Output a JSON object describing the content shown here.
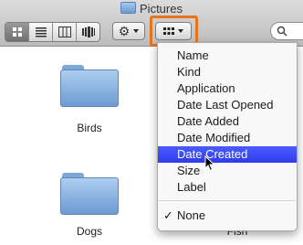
{
  "window": {
    "title": "Pictures"
  },
  "toolbar": {
    "view_modes": [
      "icon-view",
      "list-view",
      "column-view",
      "cover-flow-view"
    ],
    "action_icon": "gear-icon",
    "arrange_icon": "grid-icon"
  },
  "files": [
    {
      "name": "Birds",
      "kind": "folder"
    },
    {
      "name": "Dogs",
      "kind": "folder"
    },
    {
      "name": "Fish",
      "kind": "folder"
    }
  ],
  "arrange_menu": {
    "items": [
      "Name",
      "Kind",
      "Application",
      "Date Last Opened",
      "Date Added",
      "Date Modified",
      "Date Created",
      "Size",
      "Label"
    ],
    "highlighted": "Date Created",
    "none_label": "None",
    "checkmark": "✓"
  },
  "colors": {
    "highlight_orange": "#e8731d",
    "menu_selection": "#3a48f2"
  }
}
